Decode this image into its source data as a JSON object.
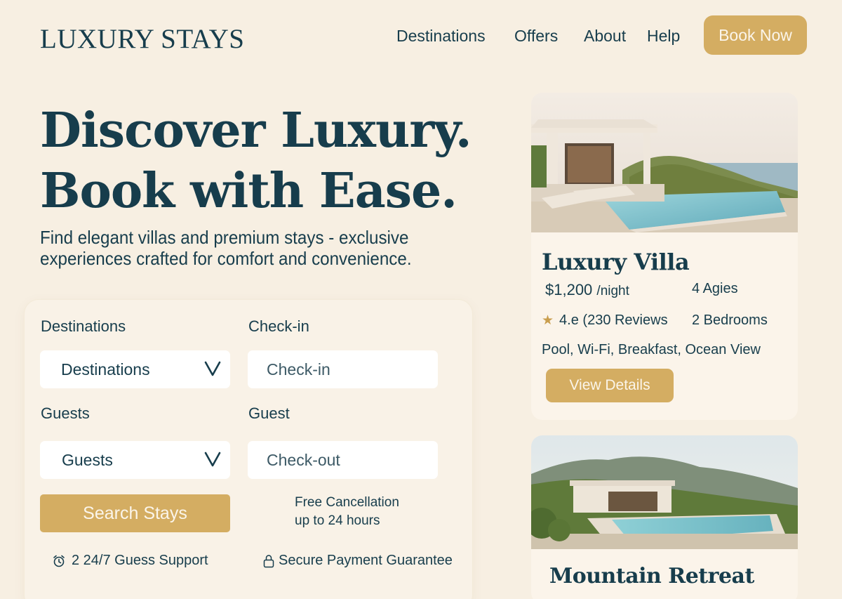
{
  "header": {
    "logo": "LUXURY STAYS",
    "nav": [
      "Destinations",
      "Offers",
      "About",
      "Help"
    ],
    "book_button": "Book Now"
  },
  "hero": {
    "title_line1": "Discover Luxury.",
    "title_line2": "Book with Ease.",
    "subtitle_line1": "Find elegant villas and premium stays - exclusive",
    "subtitle_line2": "experiences crafted for comfort and convenience."
  },
  "search": {
    "destinations_label": "Destinations",
    "destinations_value": "Destinations",
    "checkin_label": "Check-in",
    "checkin_placeholder": "Check-in",
    "guests_label": "Guests",
    "guests_value": "Guests",
    "guest_label": "Guest",
    "checkout_placeholder": "Check-out",
    "search_button": "Search Stays",
    "free_cancel_line1": "Free Cancellation",
    "free_cancel_line2": "up to 24 hours",
    "support": "2 24/7 Guess Support",
    "secure": "Secure Payment Guarantee"
  },
  "cards": [
    {
      "title": "Luxury Villa",
      "price": "$1,200",
      "price_unit": "/night",
      "guests": "4 Agies",
      "rating": "4.e (230 Reviews",
      "bedrooms": "2 Bedrooms",
      "amenities": "Pool, Wi-Fi, Breakfast, Ocean View",
      "button": "View Details"
    },
    {
      "title": "Mountain Retreat"
    }
  ],
  "colors": {
    "background": "#f7efe2",
    "primary_text": "#173d4c",
    "accent_gold": "#d4ad62",
    "card_bg": "#fbf4ea"
  }
}
